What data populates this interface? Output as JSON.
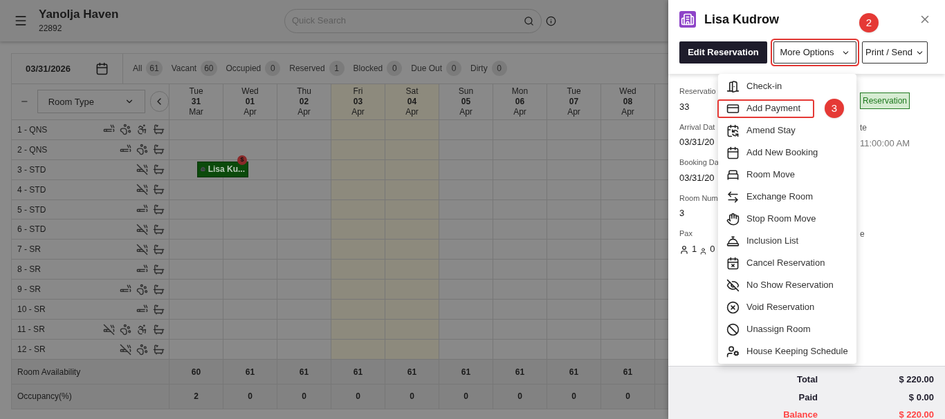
{
  "header": {
    "title": "Yanolja Haven",
    "subtitle": "22892",
    "search": {
      "placeholder": "Quick Search"
    }
  },
  "date": "03/31/2026",
  "filters": [
    {
      "label": "All",
      "count": "61"
    },
    {
      "label": "Vacant",
      "count": "60"
    },
    {
      "label": "Occupied",
      "count": "0"
    },
    {
      "label": "Reserved",
      "count": "1"
    },
    {
      "label": "Blocked",
      "count": "0"
    },
    {
      "label": "Due Out",
      "count": "0"
    },
    {
      "label": "Dirty",
      "count": "0"
    }
  ],
  "room_type_select": "Room Type",
  "days": [
    {
      "dow": "Tue",
      "day": "31",
      "month": "Mar",
      "highlighted": false
    },
    {
      "dow": "Wed",
      "day": "01",
      "month": "Apr",
      "highlighted": false
    },
    {
      "dow": "Thu",
      "day": "02",
      "month": "Apr",
      "highlighted": false
    },
    {
      "dow": "Fri",
      "day": "03",
      "month": "Apr",
      "highlighted": true
    },
    {
      "dow": "Sat",
      "day": "04",
      "month": "Apr",
      "highlighted": true
    },
    {
      "dow": "Sun",
      "day": "05",
      "month": "Apr",
      "highlighted": false
    },
    {
      "dow": "Mon",
      "day": "06",
      "month": "Apr",
      "highlighted": false
    },
    {
      "dow": "Tue",
      "day": "07",
      "month": "Apr",
      "highlighted": false
    },
    {
      "dow": "Wed",
      "day": "08",
      "month": "Apr",
      "highlighted": false
    }
  ],
  "rooms": [
    {
      "name": "1 - QNS",
      "features": [
        {
          "kind": "smoking"
        },
        {
          "kind": "pet"
        },
        {
          "kind": "wheelchair"
        },
        {
          "kind": "clean"
        }
      ]
    },
    {
      "name": "2 - QNS",
      "features": [
        {
          "kind": "smoking"
        },
        {
          "kind": "pet"
        },
        {
          "kind": "clean"
        }
      ]
    },
    {
      "name": "3 - STD",
      "features": [
        {
          "kind": "nonsmoking"
        },
        {
          "kind": "clean"
        }
      ],
      "booking": {
        "guest": "Lisa Ku...",
        "badge": "$"
      }
    },
    {
      "name": "4 - STD",
      "features": [
        {
          "kind": "nonsmoking"
        },
        {
          "kind": "clean"
        }
      ]
    },
    {
      "name": "5 - STD",
      "features": [
        {
          "kind": "smoking"
        },
        {
          "kind": "clean"
        }
      ]
    },
    {
      "name": "6 - STD",
      "features": [
        {
          "kind": "nonsmoking"
        },
        {
          "kind": "clean"
        }
      ]
    },
    {
      "name": "7 - SR",
      "features": [
        {
          "kind": "nonsmoking"
        },
        {
          "kind": "clean"
        }
      ]
    },
    {
      "name": "8 - SR",
      "features": [
        {
          "kind": "smoking"
        },
        {
          "kind": "clean"
        }
      ]
    },
    {
      "name": "9 - SR",
      "features": [
        {
          "kind": "smoking"
        },
        {
          "kind": "pet"
        },
        {
          "kind": "clean"
        }
      ]
    },
    {
      "name": "10 - SR",
      "features": [
        {
          "kind": "smoking"
        },
        {
          "kind": "clean"
        }
      ]
    },
    {
      "name": "11 - SR",
      "features": [
        {
          "kind": "nonsmoking"
        },
        {
          "kind": "pet"
        },
        {
          "kind": "wheelchair"
        },
        {
          "kind": "clean"
        }
      ]
    },
    {
      "name": "12 - SR",
      "features": [
        {
          "kind": "nonsmoking"
        },
        {
          "kind": "pet"
        },
        {
          "kind": "clean"
        }
      ]
    }
  ],
  "summary": [
    {
      "label": "Room Availability",
      "values": [
        "60",
        "61",
        "61",
        "61",
        "61",
        "61",
        "61",
        "61",
        "61"
      ]
    },
    {
      "label": "Occupancy(%)",
      "values": [
        "2",
        "0",
        "0",
        "0",
        "0",
        "0",
        "0",
        "0",
        "0"
      ]
    }
  ],
  "panel": {
    "guest": "Lisa Kudrow",
    "buttons": {
      "edit": "Edit Reservation",
      "more": {
        "label": "More Options",
        "highlighted": true,
        "step": "2"
      },
      "print": "Print / Send"
    },
    "details": [
      {
        "label": "Reservatio",
        "value": "33",
        "right_tag": "Reservation"
      },
      {
        "label": "Arrival Dat",
        "value": "03/31/20",
        "right_label": "te",
        "right_value": "11:00:00 AM"
      },
      {
        "label": "Booking Da",
        "value": "03/31/20"
      },
      {
        "label": "Room Num",
        "value": "3"
      },
      {
        "label": "Pax",
        "adults": "1",
        "children": "0",
        "right_label": "e"
      }
    ],
    "menu": [
      {
        "kind": "checkin",
        "label": "Check-in",
        "highlighted": false
      },
      {
        "kind": "payment",
        "label": "Add Payment",
        "highlighted": true,
        "step": "3"
      },
      {
        "kind": "amend",
        "label": "Amend Stay",
        "highlighted": false
      },
      {
        "kind": "booking",
        "label": "Add New Booking",
        "highlighted": false
      },
      {
        "kind": "move",
        "label": "Room Move",
        "highlighted": false
      },
      {
        "kind": "exchange",
        "label": "Exchange Room",
        "highlighted": false
      },
      {
        "kind": "stop",
        "label": "Stop Room Move",
        "highlighted": false
      },
      {
        "kind": "inclusion",
        "label": "Inclusion List",
        "highlighted": false
      },
      {
        "kind": "cancel",
        "label": "Cancel Reservation",
        "highlighted": false
      },
      {
        "kind": "noshow",
        "label": "No Show Reservation",
        "highlighted": false
      },
      {
        "kind": "void",
        "label": "Void Reservation",
        "highlighted": false
      },
      {
        "kind": "unassign",
        "label": "Unassign Room",
        "highlighted": false
      },
      {
        "kind": "housekeeping",
        "label": "House Keeping Schedule",
        "highlighted": false
      }
    ],
    "totals": [
      {
        "kind": "normal",
        "label": "Total",
        "value": "$ 220.00"
      },
      {
        "kind": "normal",
        "label": "Paid",
        "value": "$ 0.00"
      },
      {
        "kind": "alert",
        "label": "Balance",
        "value": "$ 220.00"
      }
    ]
  }
}
